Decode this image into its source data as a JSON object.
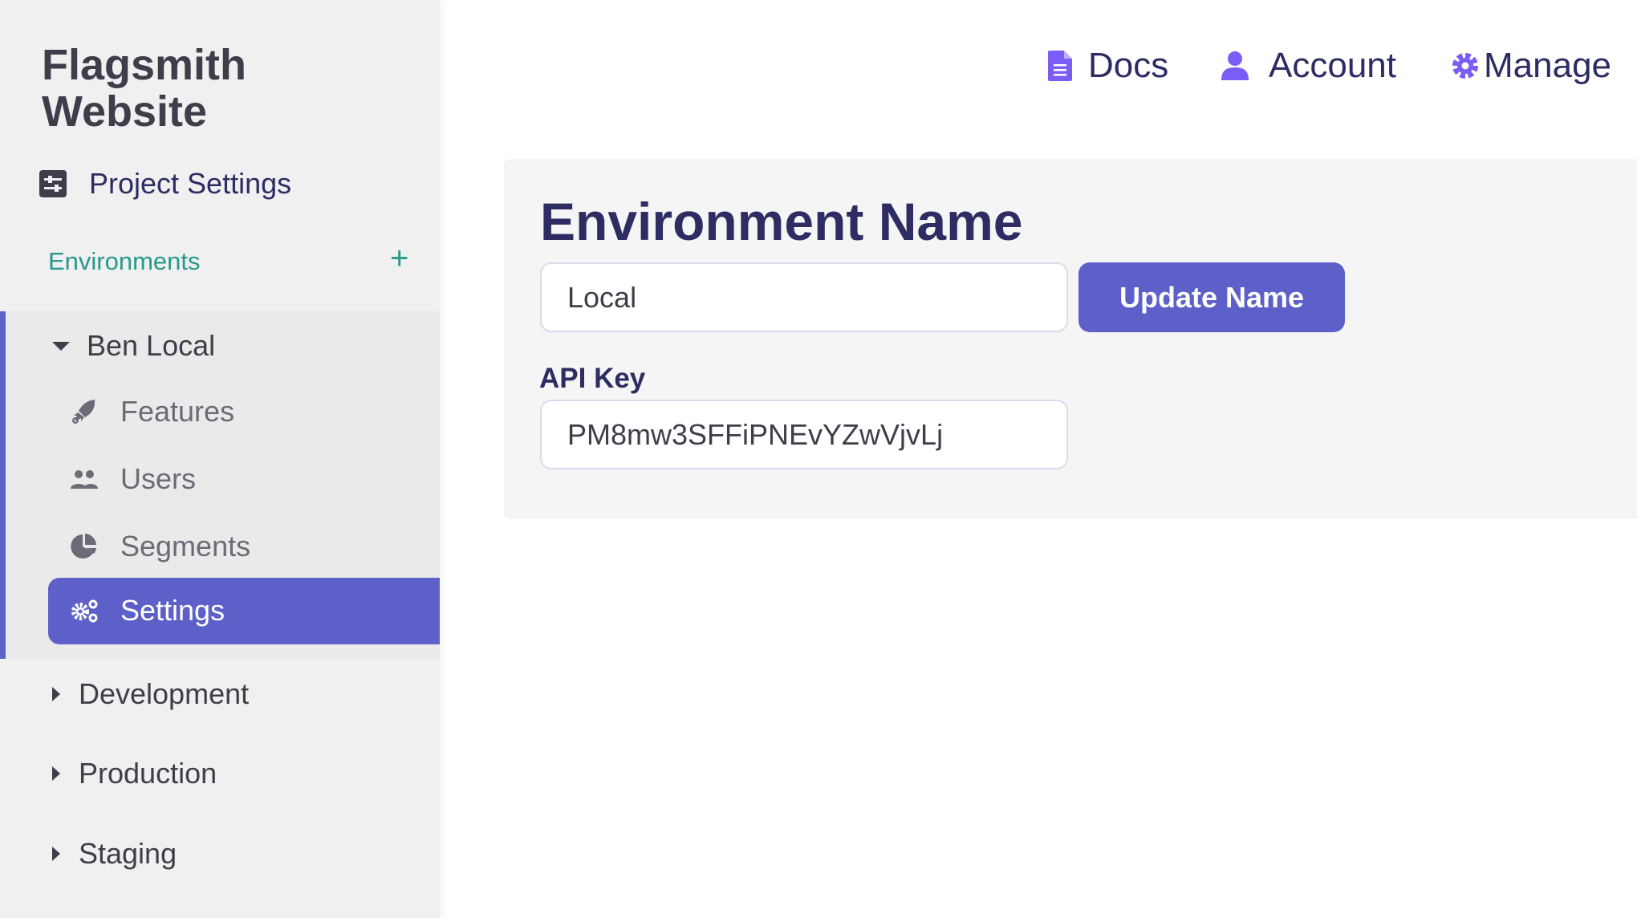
{
  "sidebar": {
    "project_title": "Flagsmith Website",
    "project_settings": "Project Settings",
    "environments_label": "Environments",
    "add_icon": "+",
    "environments": [
      {
        "name": "Ben Local",
        "expanded": true,
        "items": [
          {
            "label": "Features",
            "icon": "rocket-icon"
          },
          {
            "label": "Users",
            "icon": "users-icon"
          },
          {
            "label": "Segments",
            "icon": "pie-chart-icon"
          },
          {
            "label": "Settings",
            "icon": "cogs-icon",
            "active": true
          }
        ]
      },
      {
        "name": "Development",
        "expanded": false
      },
      {
        "name": "Production",
        "expanded": false
      },
      {
        "name": "Staging",
        "expanded": false
      }
    ]
  },
  "topnav": {
    "docs": "Docs",
    "account": "Account",
    "manage": "Manage"
  },
  "colors": {
    "accent": "#5d60c9",
    "icon_purple": "#7b5cf5",
    "teal": "#27998a",
    "heading": "#2d2c63"
  },
  "main": {
    "heading": "Environment Name",
    "name_value": "Local",
    "update_button": "Update Name",
    "api_key_label": "API Key",
    "api_key_value": "PM8mw3SFFiPNEvYZwVjvLj"
  }
}
